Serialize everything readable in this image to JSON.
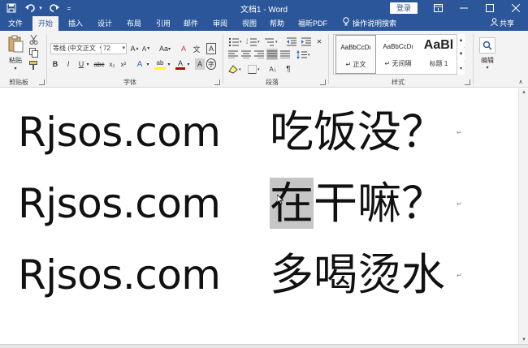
{
  "title_bar": {
    "title": "文档1 - Word",
    "login_label": "登录",
    "quick_access": [
      {
        "name": "save-icon",
        "glyph": "🖫"
      },
      {
        "name": "undo-icon",
        "glyph": "↶"
      },
      {
        "name": "redo-icon",
        "glyph": "↷"
      },
      {
        "name": "customize-icon",
        "glyph": "="
      }
    ],
    "window_controls": [
      {
        "name": "ribbon-display-icon",
        "glyph": "▣"
      },
      {
        "name": "minimize-icon",
        "glyph": "—"
      },
      {
        "name": "maximize-icon",
        "glyph": "☐"
      },
      {
        "name": "close-icon",
        "glyph": "✕"
      }
    ]
  },
  "tabs": [
    "文件",
    "开始",
    "插入",
    "设计",
    "布局",
    "引用",
    "邮件",
    "审阅",
    "视图",
    "帮助",
    "福昕PDF"
  ],
  "active_tab": "开始",
  "tell_me": "操作说明搜索",
  "share_label": "共享",
  "ribbon": {
    "clipboard": {
      "label": "剪贴板",
      "paste_label": "粘贴"
    },
    "font": {
      "label": "字体",
      "font_name": "等线 (中文正文",
      "font_size": "72",
      "buttons": {
        "grow": "A",
        "shrink": "A",
        "change_case": "Aa",
        "clear": "A",
        "phonetic": "文",
        "border": "A",
        "bold": "B",
        "italic": "I",
        "underline": "U",
        "strike": "abc",
        "subscript": "x₂",
        "superscript": "x²",
        "effects": "A",
        "highlight": "ab",
        "color": "A",
        "shading": "A",
        "enclose": "字"
      }
    },
    "paragraph": {
      "label": "段落"
    },
    "styles": {
      "label": "样式",
      "items": [
        {
          "preview": "AaBbCcDı",
          "name": "↵ 正文"
        },
        {
          "preview": "AaBbCcDı",
          "name": "↵ 无间隔"
        },
        {
          "preview": "AaBl",
          "name": "标题 1"
        }
      ]
    },
    "editing": {
      "label": "编辑"
    }
  },
  "document": {
    "lines": [
      {
        "latin": "Rjsos.com",
        "cjk_highlight": "",
        "cjk": "吃饭没？"
      },
      {
        "latin": "Rjsos.com",
        "cjk_highlight": "在",
        "cjk": "干嘛？"
      },
      {
        "latin": "Rjsos.com",
        "cjk_highlight": "",
        "cjk": "多喝烫水"
      }
    ],
    "paragraph_mark": "↵"
  },
  "colors": {
    "accent": "#2b579a",
    "ribbon_bg": "#f3f3f3",
    "selection": "#c6c6c6"
  }
}
